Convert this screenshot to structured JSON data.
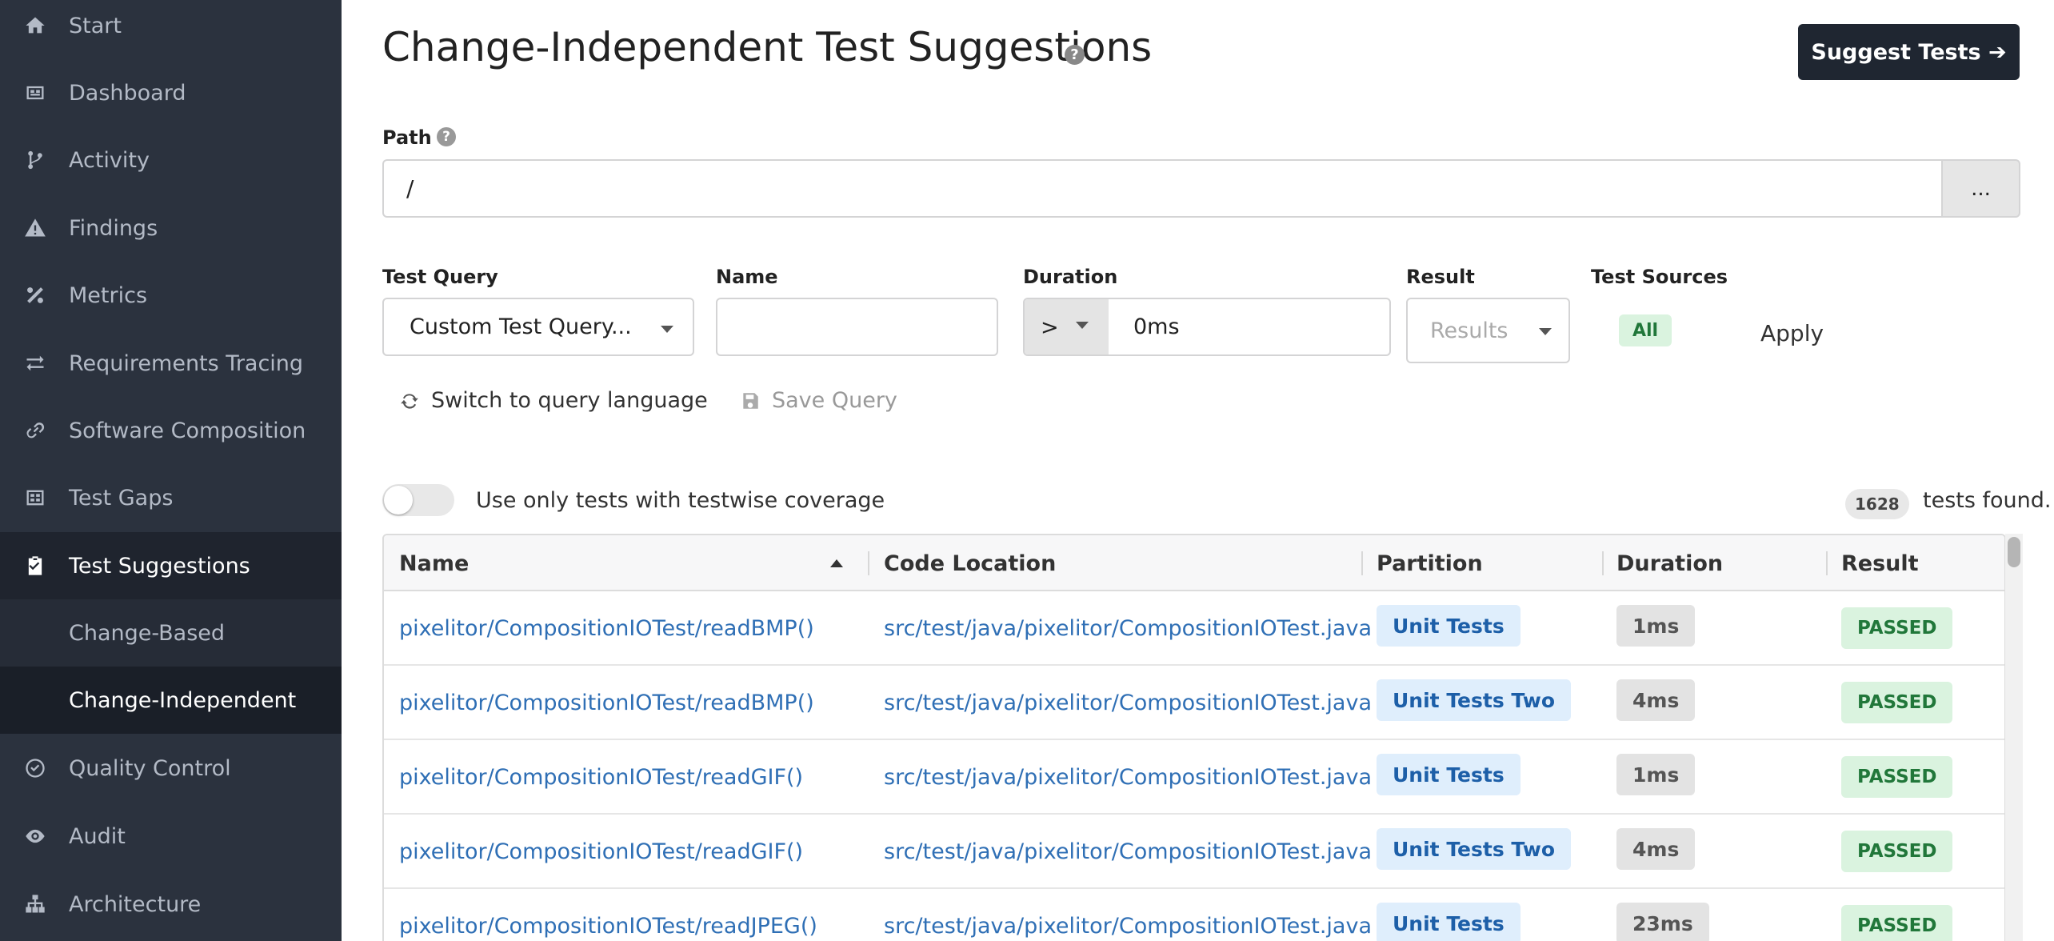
{
  "sidebar": {
    "items": [
      {
        "label": "Start",
        "icon": "home-icon"
      },
      {
        "label": "Dashboard",
        "icon": "dashboard-icon"
      },
      {
        "label": "Activity",
        "icon": "code-branch-icon"
      },
      {
        "label": "Findings",
        "icon": "warning-icon"
      },
      {
        "label": "Metrics",
        "icon": "percent-icon"
      },
      {
        "label": "Requirements Tracing",
        "icon": "exchange-icon"
      },
      {
        "label": "Software Composition",
        "icon": "link-icon"
      },
      {
        "label": "Test Gaps",
        "icon": "gap-icon"
      },
      {
        "label": "Test Suggestions",
        "icon": "clipboard-check-icon"
      },
      {
        "label": "Quality Control",
        "icon": "check-circle-icon"
      },
      {
        "label": "Audit",
        "icon": "eye-icon"
      },
      {
        "label": "Architecture",
        "icon": "sitemap-icon"
      }
    ],
    "subitems": [
      {
        "label": "Change-Based"
      },
      {
        "label": "Change-Independent"
      }
    ]
  },
  "header": {
    "title": "Change-Independent Test Suggestions",
    "help": "?",
    "suggest_button": "Suggest Tests ➔"
  },
  "path": {
    "label": "Path",
    "help": "?",
    "value": "/",
    "browse_button": "..."
  },
  "filters": {
    "test_query_label": "Test Query",
    "test_query_value": "Custom Test Query...",
    "name_label": "Name",
    "name_value": "",
    "duration_label": "Duration",
    "duration_operator": ">",
    "duration_value": "0ms",
    "result_label": "Result",
    "result_placeholder": "Results",
    "test_sources_label": "Test Sources",
    "test_sources_value": "All",
    "apply_button": "Apply"
  },
  "actions": {
    "switch_query": "Switch to query language",
    "save_query": "Save Query"
  },
  "coverage_toggle": {
    "label": "Use only tests with testwise coverage",
    "on": false
  },
  "results": {
    "count": "1628",
    "suffix": "tests found."
  },
  "table": {
    "columns": [
      "Name",
      "Code Location",
      "Partition",
      "Duration",
      "Result"
    ],
    "rows": [
      {
        "name": "pixelitor/CompositionIOTest/readBMP()",
        "location": "src/test/java/pixelitor/CompositionIOTest.java",
        "partition": "Unit Tests",
        "duration": "1ms",
        "result": "PASSED"
      },
      {
        "name": "pixelitor/CompositionIOTest/readBMP()",
        "location": "src/test/java/pixelitor/CompositionIOTest.java",
        "partition": "Unit Tests Two",
        "duration": "4ms",
        "result": "PASSED"
      },
      {
        "name": "pixelitor/CompositionIOTest/readGIF()",
        "location": "src/test/java/pixelitor/CompositionIOTest.java",
        "partition": "Unit Tests",
        "duration": "1ms",
        "result": "PASSED"
      },
      {
        "name": "pixelitor/CompositionIOTest/readGIF()",
        "location": "src/test/java/pixelitor/CompositionIOTest.java",
        "partition": "Unit Tests Two",
        "duration": "4ms",
        "result": "PASSED"
      },
      {
        "name": "pixelitor/CompositionIOTest/readJPEG()",
        "location": "src/test/java/pixelitor/CompositionIOTest.java",
        "partition": "Unit Tests",
        "duration": "23ms",
        "result": "PASSED"
      }
    ]
  },
  "colors": {
    "sidebar_bg": "#2b323e",
    "link": "#2f6fb5",
    "passed_bg": "#daf3df",
    "passed_text": "#21773a",
    "partition_bg": "#dfeefc"
  }
}
